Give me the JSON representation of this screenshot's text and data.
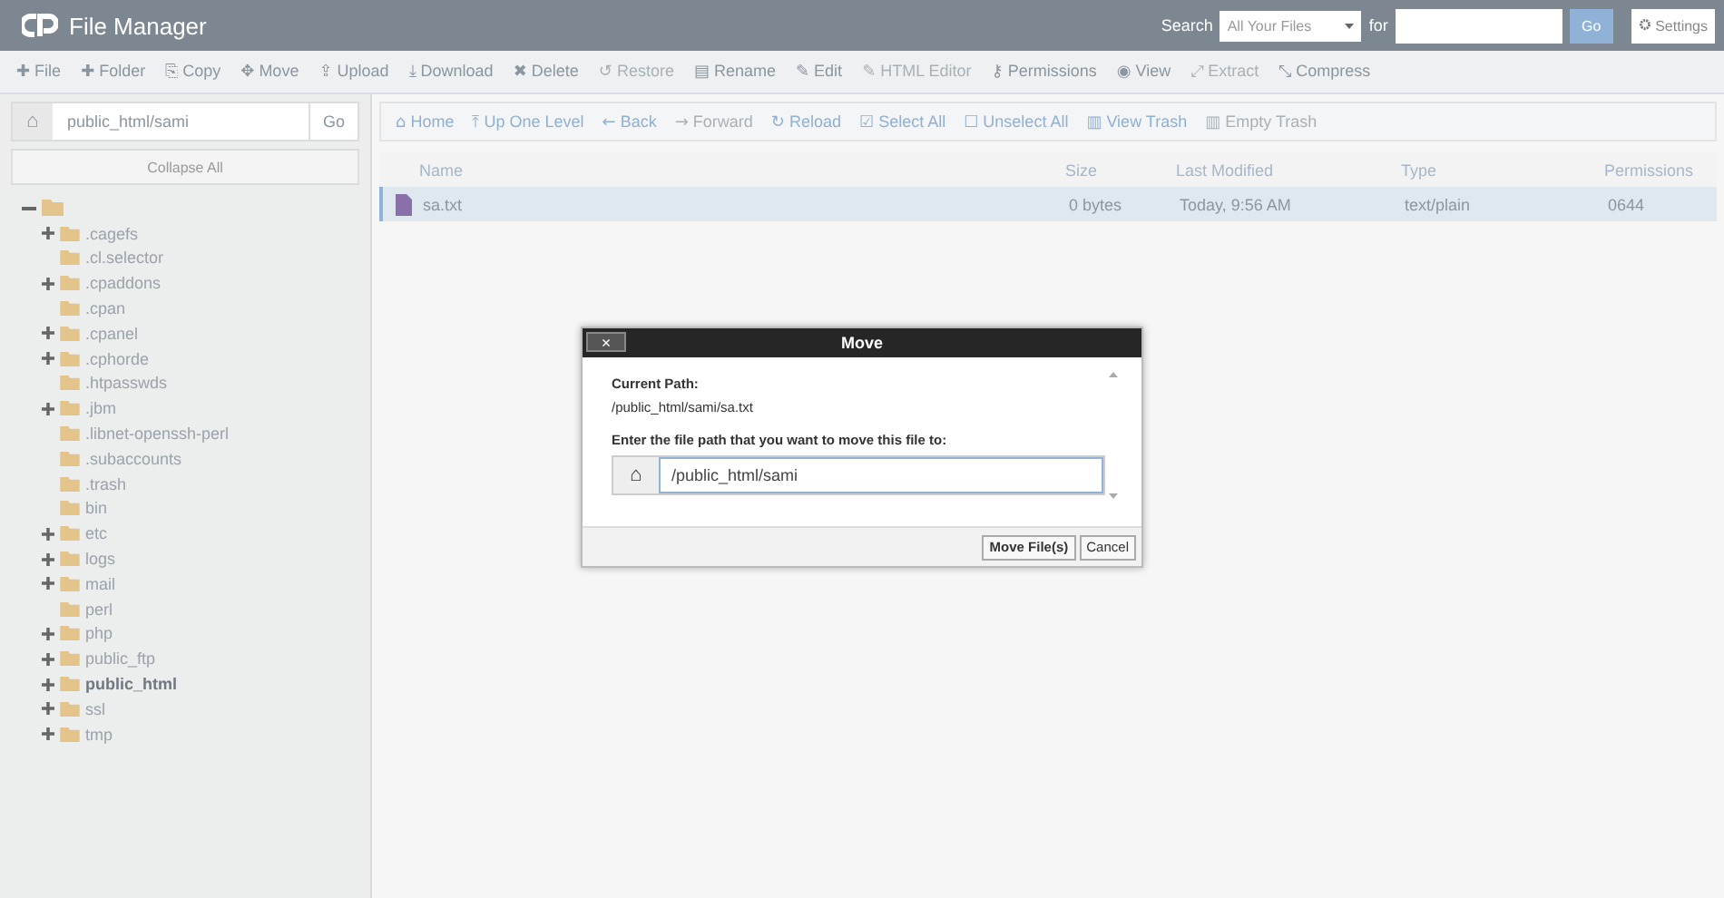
{
  "header": {
    "title": "File Manager",
    "search_label": "Search",
    "search_scope": "All Your Files",
    "for_label": "for",
    "go": "Go",
    "settings": "Settings"
  },
  "toolbar": [
    {
      "icon": "✚",
      "label": "File",
      "disabled": false
    },
    {
      "icon": "✚",
      "label": "Folder",
      "disabled": false
    },
    {
      "icon": "⎘",
      "label": "Copy",
      "disabled": false
    },
    {
      "icon": "✥",
      "label": "Move",
      "disabled": false
    },
    {
      "icon": "⇪",
      "label": "Upload",
      "disabled": false
    },
    {
      "icon": "⤓",
      "label": "Download",
      "disabled": false
    },
    {
      "icon": "✖",
      "label": "Delete",
      "disabled": false
    },
    {
      "icon": "↺",
      "label": "Restore",
      "disabled": true
    },
    {
      "icon": "▤",
      "label": "Rename",
      "disabled": false
    },
    {
      "icon": "✎",
      "label": "Edit",
      "disabled": false
    },
    {
      "icon": "✎",
      "label": "HTML Editor",
      "disabled": true
    },
    {
      "icon": "⚷",
      "label": "Permissions",
      "disabled": false
    },
    {
      "icon": "◉",
      "label": "View",
      "disabled": false
    },
    {
      "icon": "⤢",
      "label": "Extract",
      "disabled": true
    },
    {
      "icon": "⤡",
      "label": "Compress",
      "disabled": false
    }
  ],
  "sidebar": {
    "path": "public_html/sami",
    "go": "Go",
    "collapse": "Collapse All",
    "tree": [
      {
        "expanded": true,
        "children": [
          {
            "label": ".cagefs",
            "expandable": true,
            "selected": false
          },
          {
            "label": ".cl.selector",
            "expandable": false,
            "selected": false
          },
          {
            "label": ".cpaddons",
            "expandable": true,
            "selected": false
          },
          {
            "label": ".cpan",
            "expandable": false,
            "selected": false
          },
          {
            "label": ".cpanel",
            "expandable": true,
            "selected": false
          },
          {
            "label": ".cphorde",
            "expandable": true,
            "selected": false
          },
          {
            "label": ".htpasswds",
            "expandable": false,
            "selected": false
          },
          {
            "label": ".jbm",
            "expandable": true,
            "selected": false
          },
          {
            "label": ".libnet-openssh-perl",
            "expandable": false,
            "selected": false
          },
          {
            "label": ".subaccounts",
            "expandable": false,
            "selected": false
          },
          {
            "label": ".trash",
            "expandable": false,
            "selected": false
          },
          {
            "label": "bin",
            "expandable": false,
            "selected": false
          },
          {
            "label": "etc",
            "expandable": true,
            "selected": false
          },
          {
            "label": "logs",
            "expandable": true,
            "selected": false
          },
          {
            "label": "mail",
            "expandable": true,
            "selected": false
          },
          {
            "label": "perl",
            "expandable": false,
            "selected": false
          },
          {
            "label": "php",
            "expandable": true,
            "selected": false
          },
          {
            "label": "public_ftp",
            "expandable": true,
            "selected": false
          },
          {
            "label": "public_html",
            "expandable": true,
            "selected": true
          },
          {
            "label": "ssl",
            "expandable": true,
            "selected": false
          },
          {
            "label": "tmp",
            "expandable": true,
            "selected": false
          }
        ]
      }
    ]
  },
  "nav": [
    {
      "icon": "⌂",
      "label": "Home",
      "disabled": false
    },
    {
      "icon": "⤒",
      "label": "Up One Level",
      "disabled": false
    },
    {
      "icon": "←",
      "label": "Back",
      "disabled": false
    },
    {
      "icon": "→",
      "label": "Forward",
      "disabled": true
    },
    {
      "icon": "↻",
      "label": "Reload",
      "disabled": false
    },
    {
      "icon": "☑",
      "label": "Select All",
      "disabled": false
    },
    {
      "icon": "☐",
      "label": "Unselect All",
      "disabled": false
    },
    {
      "icon": "▥",
      "label": "View Trash",
      "disabled": false
    },
    {
      "icon": "▥",
      "label": "Empty Trash",
      "disabled": true
    }
  ],
  "table": {
    "columns": [
      "Name",
      "Size",
      "Last Modified",
      "Type",
      "Permissions"
    ],
    "rows": [
      {
        "name": "sa.txt",
        "size": "0 bytes",
        "modified": "Today, 9:56 AM",
        "type": "text/plain",
        "permissions": "0644",
        "selected": true
      }
    ]
  },
  "dialog": {
    "close": "×",
    "title": "Move",
    "current_label": "Current Path:",
    "current_path": "/public_html/sami/sa.txt",
    "prompt": "Enter the file path that you want to move this file to:",
    "value": "/public_html/sami",
    "buttons": [
      "Move File(s)",
      "Cancel"
    ]
  }
}
